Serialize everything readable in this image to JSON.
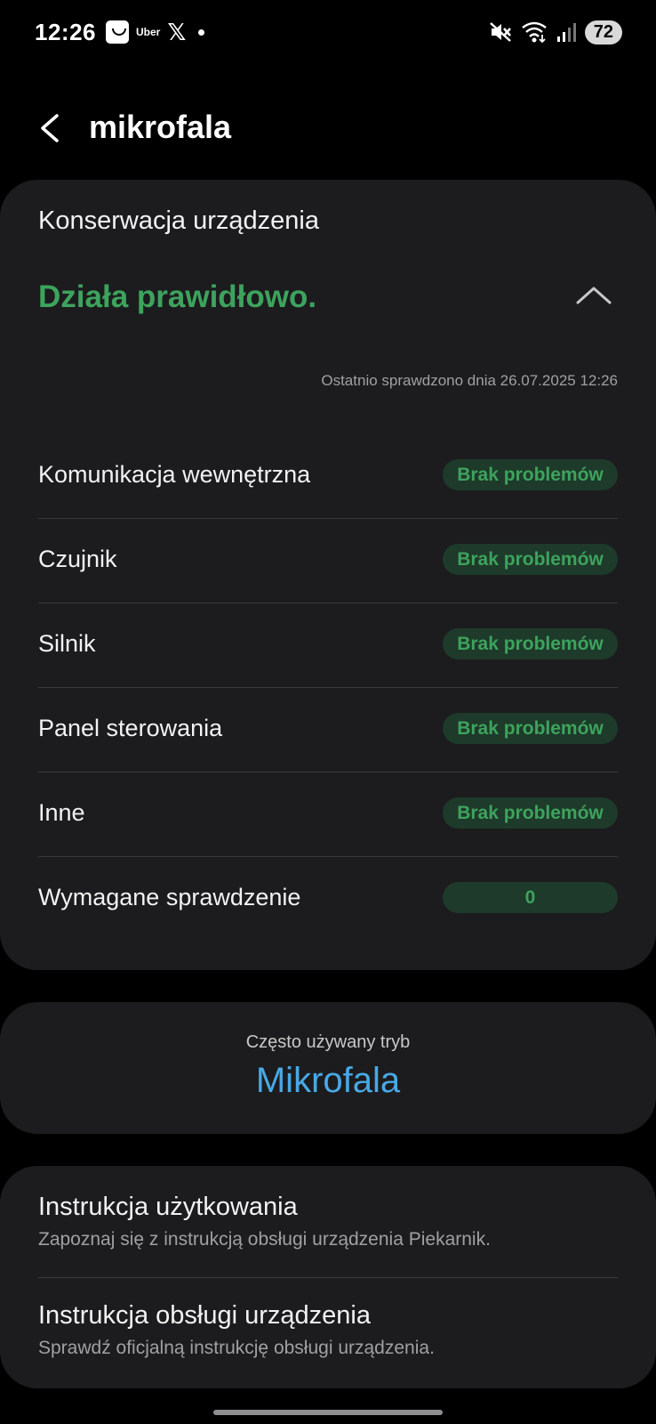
{
  "status_bar": {
    "time": "12:26",
    "uber_label": "Uber",
    "x_label": "𝕏",
    "battery": "72"
  },
  "header": {
    "title": "mikrofala"
  },
  "maintenance": {
    "title": "Konserwacja urządzenia",
    "status": "Działa prawidłowo.",
    "last_checked": "Ostatnio sprawdzono dnia 26.07.2025 12:26",
    "rows": [
      {
        "label": "Komunikacja wewnętrzna",
        "value": "Brak problemów"
      },
      {
        "label": "Czujnik",
        "value": "Brak problemów"
      },
      {
        "label": "Silnik",
        "value": "Brak problemów"
      },
      {
        "label": "Panel sterowania",
        "value": "Brak problemów"
      },
      {
        "label": "Inne",
        "value": "Brak problemów"
      },
      {
        "label": "Wymagane sprawdzenie",
        "value": "0"
      }
    ]
  },
  "frequent_mode": {
    "caption": "Często używany tryb",
    "value": "Mikrofala"
  },
  "manuals": {
    "items": [
      {
        "title": "Instrukcja użytkowania",
        "description": "Zapoznaj się z instrukcją obsługi urządzenia Piekarnik."
      },
      {
        "title": "Instrukcja obsługi urządzenia",
        "description": "Sprawdź oficjalną instrukcję obsługi urządzenia."
      }
    ]
  },
  "colors": {
    "background": "#000000",
    "card": "#1c1c1e",
    "ok_green": "#3da35d",
    "badge_bg": "#1e3a2a",
    "mode_blue": "#48a9e6"
  }
}
